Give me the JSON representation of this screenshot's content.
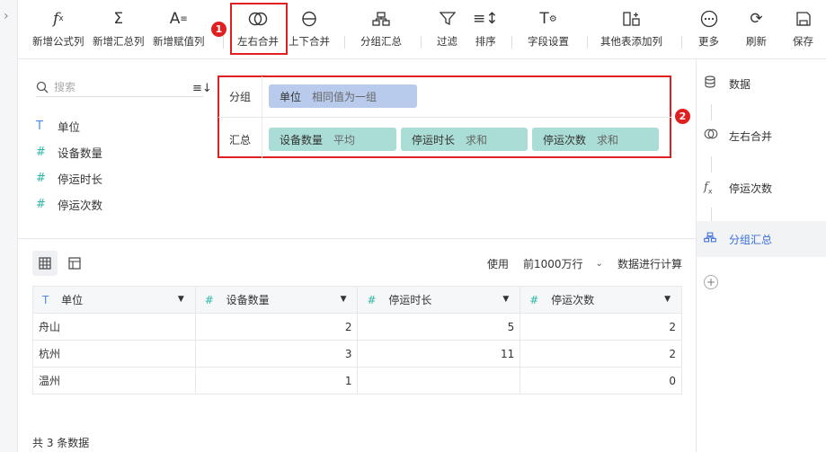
{
  "toolbar": {
    "items": [
      {
        "label": "新增公式列",
        "icon": "fx-icon"
      },
      {
        "label": "新增汇总列",
        "icon": "sigma-icon"
      },
      {
        "label": "新增赋值列",
        "icon": "assign-icon"
      },
      {
        "label": "左右合并",
        "icon": "merge-horizontal-icon"
      },
      {
        "label": "上下合并",
        "icon": "merge-vertical-icon"
      },
      {
        "label": "分组汇总",
        "icon": "group-summary-icon"
      },
      {
        "label": "过滤",
        "icon": "filter-icon"
      },
      {
        "label": "排序",
        "icon": "sort-icon"
      },
      {
        "label": "字段设置",
        "icon": "field-settings-icon"
      },
      {
        "label": "其他表添加列",
        "icon": "add-column-icon"
      },
      {
        "label": "更多",
        "icon": "more-icon"
      },
      {
        "label": "刷新",
        "icon": "refresh-icon"
      },
      {
        "label": "保存",
        "icon": "save-icon"
      }
    ]
  },
  "annotations": {
    "badge1": "1",
    "badge2": "2"
  },
  "fields": {
    "search_placeholder": "搜索",
    "items": [
      {
        "name": "单位",
        "type": "T"
      },
      {
        "name": "设备数量",
        "type": "#"
      },
      {
        "name": "停运时长",
        "type": "#"
      },
      {
        "name": "停运次数",
        "type": "#"
      }
    ]
  },
  "config": {
    "group_label": "分组",
    "group_pill": {
      "field": "单位",
      "desc": "相同值为一组"
    },
    "summary_label": "汇总",
    "summary_pills": [
      {
        "field": "设备数量",
        "agg": "平均"
      },
      {
        "field": "停运时长",
        "agg": "求和"
      },
      {
        "field": "停运次数",
        "agg": "求和"
      }
    ]
  },
  "view": {
    "use_label": "使用",
    "rows_option": "前1000万行",
    "calc_label": "数据进行计算"
  },
  "table": {
    "headers": [
      {
        "name": "单位",
        "type": "T"
      },
      {
        "name": "设备数量",
        "type": "#"
      },
      {
        "name": "停运时长",
        "type": "#"
      },
      {
        "name": "停运次数",
        "type": "#"
      }
    ],
    "rows": [
      [
        "舟山",
        "2",
        "5",
        "2"
      ],
      [
        "杭州",
        "3",
        "11",
        "2"
      ],
      [
        "温州",
        "1",
        "",
        "0"
      ]
    ],
    "footer": "共 3 条数据"
  },
  "steps": {
    "items": [
      {
        "label": "数据",
        "icon": "database-icon"
      },
      {
        "label": "左右合并",
        "icon": "merge-horizontal-icon"
      },
      {
        "label": "停运次数",
        "icon": "fx-icon"
      },
      {
        "label": "分组汇总",
        "icon": "group-summary-icon"
      }
    ],
    "active_index": 3
  },
  "colors": {
    "accent": "#3b6fd6",
    "group_pill": "#b9cbec",
    "summary_pill": "#a9ddd6",
    "highlight": "#e02020"
  }
}
